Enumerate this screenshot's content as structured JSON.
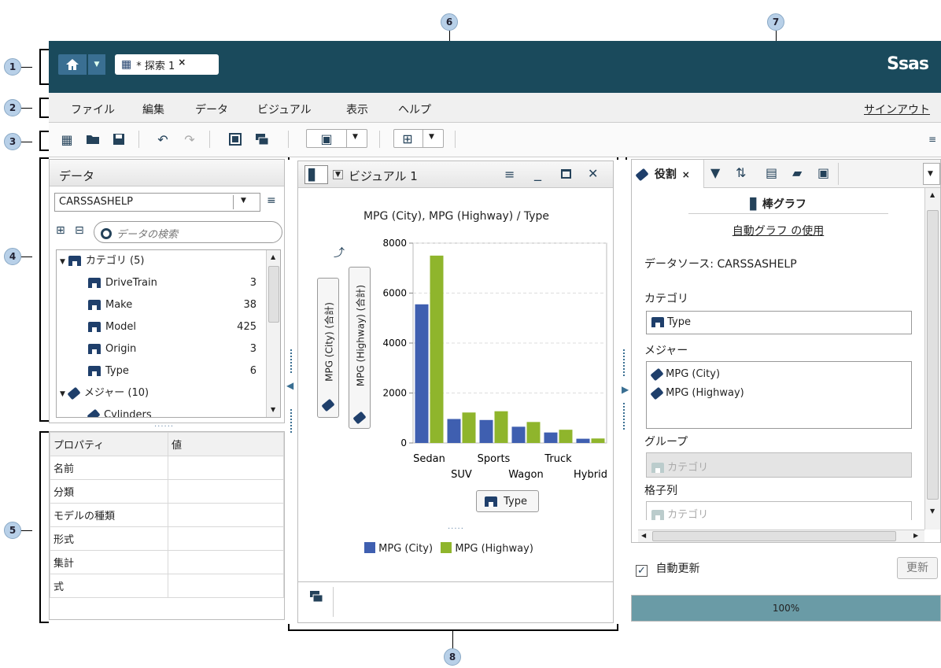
{
  "callouts": [
    "1",
    "2",
    "3",
    "4",
    "5",
    "6",
    "7",
    "8"
  ],
  "topbar": {
    "tab_label": "* 探索 1",
    "tab_close": "×",
    "logo": "Ssas",
    "bg": "#1a4a5c"
  },
  "menu": {
    "items": [
      "ファイル",
      "編集",
      "データ",
      "ビジュアル",
      "表示",
      "ヘルプ"
    ],
    "signout": "サインアウト"
  },
  "data_panel": {
    "title": "データ",
    "source": "CARSSASHELP",
    "search_placeholder": "データの検索",
    "tree": [
      {
        "label": "カテゴリ (5)",
        "count": "",
        "kind": "group-cat"
      },
      {
        "label": "DriveTrain",
        "count": "3",
        "kind": "cat"
      },
      {
        "label": "Make",
        "count": "38",
        "kind": "cat"
      },
      {
        "label": "Model",
        "count": "425",
        "kind": "cat"
      },
      {
        "label": "Origin",
        "count": "3",
        "kind": "cat"
      },
      {
        "label": "Type",
        "count": "6",
        "kind": "cat"
      },
      {
        "label": "メジャー (10)",
        "count": "",
        "kind": "group-meas"
      },
      {
        "label": "Cylinders",
        "count": "",
        "kind": "meas"
      }
    ]
  },
  "props": {
    "headers": [
      "プロパティ",
      "値"
    ],
    "rows": [
      "名前",
      "分類",
      "モデルの種類",
      "形式",
      "集計",
      "式"
    ]
  },
  "visual": {
    "title": "ビジュアル 1",
    "yrole1": "MPG (City) (合計)",
    "yrole2": "MPG (Highway) (合計)",
    "xrole": "Type"
  },
  "chart_data": {
    "type": "bar",
    "title": "MPG (City), MPG (Highway) / Type",
    "categories": [
      "Sedan",
      "SUV",
      "Sports",
      "Wagon",
      "Truck",
      "Hybrid"
    ],
    "series": [
      {
        "name": "MPG (City)",
        "values": [
          5550,
          960,
          920,
          650,
          420,
          170
        ],
        "color": "#3f5fb0"
      },
      {
        "name": "MPG (Highway)",
        "values": [
          7500,
          1220,
          1270,
          840,
          530,
          180
        ],
        "color": "#8fb52c"
      }
    ],
    "yticks": [
      "0",
      "2000",
      "4000",
      "6000",
      "8000"
    ],
    "ylim": [
      0,
      8000
    ],
    "grid": true,
    "legend_position": "bottom"
  },
  "roles_panel": {
    "tab_label": "役割",
    "tab_close": "×",
    "chart_type": "棒グラフ",
    "auto_chart_link": "自動グラフ の使用",
    "datasource": "データソース: CARSSASHELP",
    "category_label": "カテゴリ",
    "category_value": "Type",
    "measure_label": "メジャー",
    "measures": [
      "MPG (City)",
      "MPG (Highway)"
    ],
    "group_label": "グループ",
    "group_placeholder": "カテゴリ",
    "lattice_label": "格子列",
    "lattice_placeholder": "カテゴリ",
    "auto_update": "自動更新",
    "update_button": "更新",
    "progress_text": "100%",
    "progress": 1.0
  }
}
